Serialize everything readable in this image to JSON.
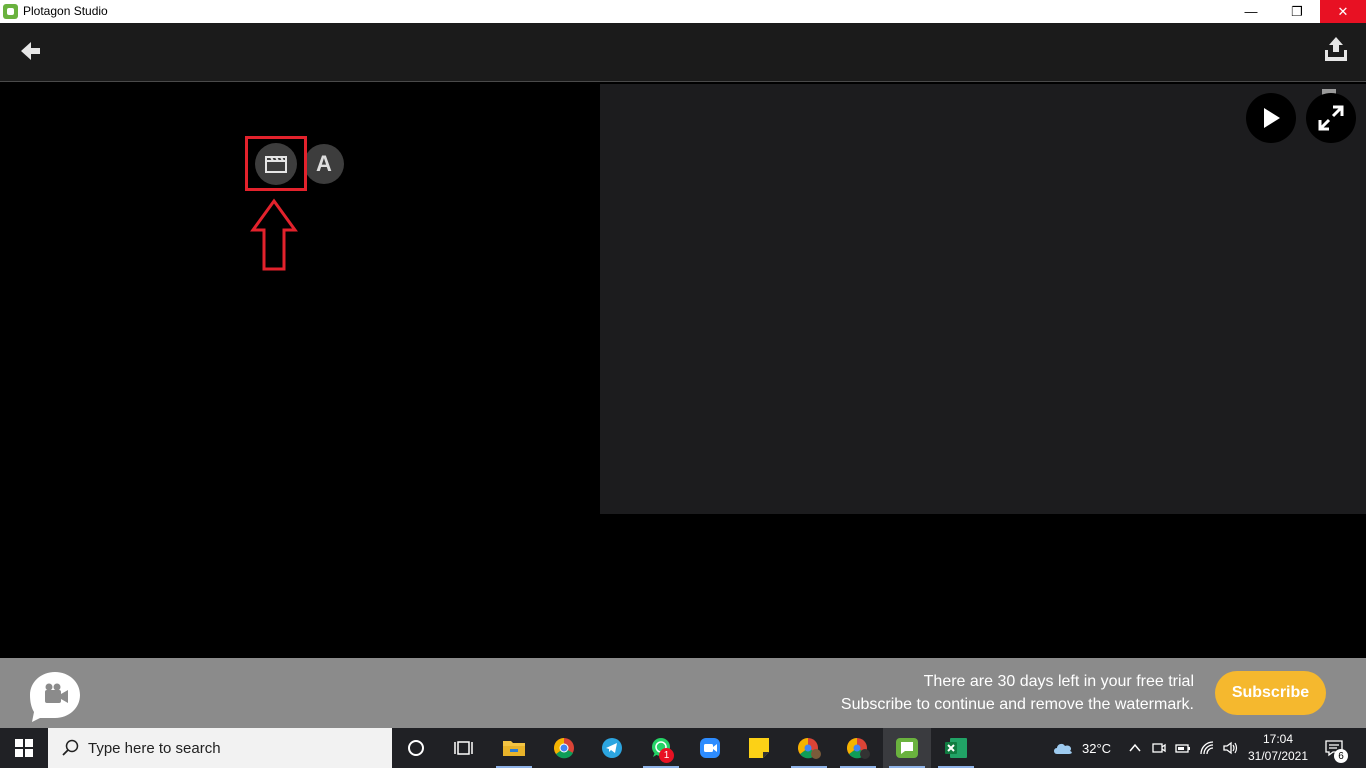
{
  "window": {
    "title": "Plotagon Studio",
    "minimize_glyph": "—",
    "maximize_glyph": "❐",
    "close_glyph": "✕"
  },
  "toolbar": {
    "back_icon": "arrow-left-icon",
    "share_icon": "export-upload-icon"
  },
  "editor": {
    "scene_button_icon": "clapperboard-icon",
    "text_button_label": "A",
    "annotation": {
      "highlight_color": "#e3222c",
      "arrow_icon": "up-arrow-outline-icon"
    }
  },
  "preview": {
    "play_icon": "play-icon",
    "fullscreen_icon": "expand-icon",
    "watermark_icon": "plotagon-logo-icon"
  },
  "trial_banner": {
    "line1": "There are 30 days left in your free trial",
    "line2": "Subscribe to continue and remove the watermark.",
    "subscribe_label": "Subscribe",
    "accent_color": "#f5b82e"
  },
  "taskbar": {
    "search_placeholder": "Type here to search",
    "apps": [
      {
        "name": "cortana-icon"
      },
      {
        "name": "task-view-icon"
      },
      {
        "name": "file-explorer-icon"
      },
      {
        "name": "chrome-icon"
      },
      {
        "name": "telegram-icon"
      },
      {
        "name": "whatsapp-icon",
        "badge": "1"
      },
      {
        "name": "zoom-icon"
      },
      {
        "name": "sticky-notes-icon"
      },
      {
        "name": "chrome-profile-icon"
      },
      {
        "name": "chrome-profile-2-icon"
      },
      {
        "name": "plotagon-icon"
      },
      {
        "name": "excel-icon"
      }
    ],
    "weather": "32°C",
    "time": "17:04",
    "date": "31/07/2021",
    "notification_count": "6"
  }
}
